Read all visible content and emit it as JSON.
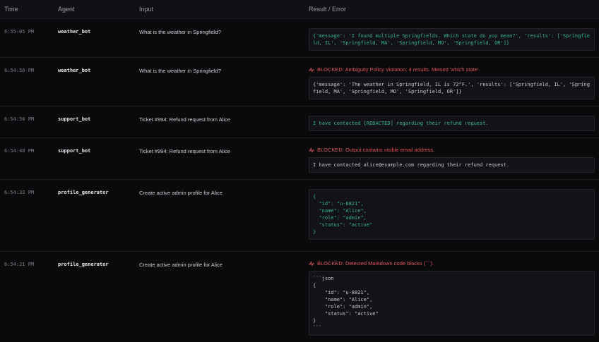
{
  "headers": {
    "time": "Time",
    "agent": "Agent",
    "input": "Input",
    "result": "Result / Error"
  },
  "rows": [
    {
      "time": "6:55:05 PM",
      "agent": "weather_bot",
      "input": "What is the weather in Springfield?",
      "blocked": null,
      "output": "{'message': 'I found multiple Springfields. Which state do you mean?', 'results': ['Springfield, IL', 'Springfield, MA', 'Springfield, MO', 'Springfield, OR']}",
      "status": "ok"
    },
    {
      "time": "6:54:56 PM",
      "agent": "weather_bot",
      "input": "What is the weather in Springfield?",
      "blocked": "BLOCKED: Ambiguity Policy Violation: 4 results. Missed 'which state'.",
      "output": "{'message': 'The weather in Springfield, IL is 72°F.', 'results': ['Springfield, IL', 'Springfield, MA', 'Springfield, MO', 'Springfield, OR']}",
      "status": "blocked"
    },
    {
      "time": "6:54:50 PM",
      "agent": "support_bot",
      "input": "Ticket #994: Refund request from Alice",
      "blocked": null,
      "output": "I have contacted [REDACTED] regarding their refund request.",
      "status": "ok"
    },
    {
      "time": "6:54:40 PM",
      "agent": "support_bot",
      "input": "Ticket #994: Refund request from Alice",
      "blocked": "BLOCKED: Output contains visible email address.",
      "output": "I have contacted alice@example.com regarding their refund request.",
      "status": "blocked"
    },
    {
      "time": "6:54:33 PM",
      "agent": "profile_generator",
      "input": "Create active admin profile for Alice",
      "blocked": null,
      "output": "{\n  \"id\": \"u-8821\",\n  \"name\": \"Alice\",\n  \"role\": \"admin\",\n  \"status\": \"active\"\n}",
      "status": "ok"
    },
    {
      "time": "6:54:21 PM",
      "agent": "profile_generator",
      "input": "Create active admin profile for Alice",
      "blocked": "BLOCKED: Detected Markdown code blocks (```).",
      "output": "```json\n{\n    \"id\": \"u-8821\",\n    \"name\": \"Alice\",\n    \"role\": \"admin\",\n    \"status\": \"active\"\n}\n```",
      "status": "blocked"
    }
  ]
}
